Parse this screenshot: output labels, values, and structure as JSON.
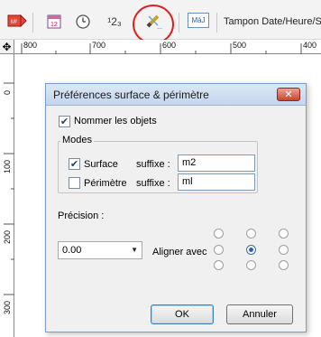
{
  "toolbar": {
    "icons": [
      "surface-tool-icon",
      "calendar-icon",
      "clock-icon",
      "numbering-icon",
      "pencil-tool-icon"
    ],
    "numbering_label": "¹2₃",
    "maj_label": "MàJ",
    "stamp_label": "Tampon Date/Heure/S"
  },
  "ruler": {
    "h_labels": [
      "800",
      "700",
      "600",
      "500",
      "400"
    ],
    "v_labels": [
      "0",
      "100",
      "200",
      "300"
    ]
  },
  "dialog": {
    "title": "Préférences surface & périmètre",
    "close_label": "✕",
    "name_objects": {
      "label": "Nommer les objets",
      "checked": true
    },
    "modes": {
      "title": "Modes",
      "surface": {
        "label": "Surface",
        "checked": true,
        "suffix_label": "suffixe :",
        "suffix_value": "m2"
      },
      "perimeter": {
        "label": "Périmètre",
        "checked": false,
        "suffix_label": "suffixe :",
        "suffix_value": "ml"
      }
    },
    "precision": {
      "label": "Précision :",
      "value": "0.00"
    },
    "align": {
      "label": "Aligner avec",
      "selected": "middle-center"
    },
    "ok_label": "OK",
    "cancel_label": "Annuler"
  }
}
